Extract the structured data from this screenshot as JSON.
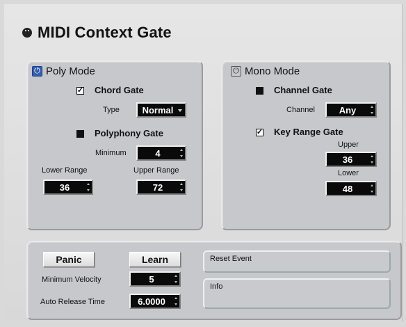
{
  "window": {
    "title": "MIDI Context Gate"
  },
  "poly": {
    "header": "Poly Mode",
    "power_on": true,
    "chord_gate": {
      "label": "Chord Gate",
      "checked": true
    },
    "type_label": "Type",
    "type_value": "Normal",
    "polyphony_gate": {
      "label": "Polyphony Gate",
      "checked": false
    },
    "minimum_label": "Minimum",
    "minimum_value": "4",
    "lower_range_label": "Lower Range",
    "lower_range_value": "36",
    "upper_range_label": "Upper Range",
    "upper_range_value": "72"
  },
  "mono": {
    "header": "Mono Mode",
    "power_on": false,
    "channel_gate": {
      "label": "Channel Gate",
      "checked": false
    },
    "channel_label": "Channel",
    "channel_value": "Any",
    "key_range_gate": {
      "label": "Key Range Gate",
      "checked": true
    },
    "upper_label": "Upper",
    "upper_value": "36",
    "lower_label": "Lower",
    "lower_value": "48"
  },
  "bottom": {
    "panic_label": "Panic",
    "learn_label": "Learn",
    "min_velocity_label": "Minimum Velocity",
    "min_velocity_value": "5",
    "auto_release_label": "Auto Release Time",
    "auto_release_value": "6.0000",
    "reset_event_label": "Reset Event",
    "info_label": "Info"
  },
  "colors": {
    "panel": "#c7c8cc",
    "background": "#d9d9d9",
    "field_bg": "#0a0a0a",
    "power_on": "#2f5fb3"
  },
  "icons": {
    "title": "midi-port-icon",
    "power": "power-icon",
    "check": "checkmark-icon"
  }
}
